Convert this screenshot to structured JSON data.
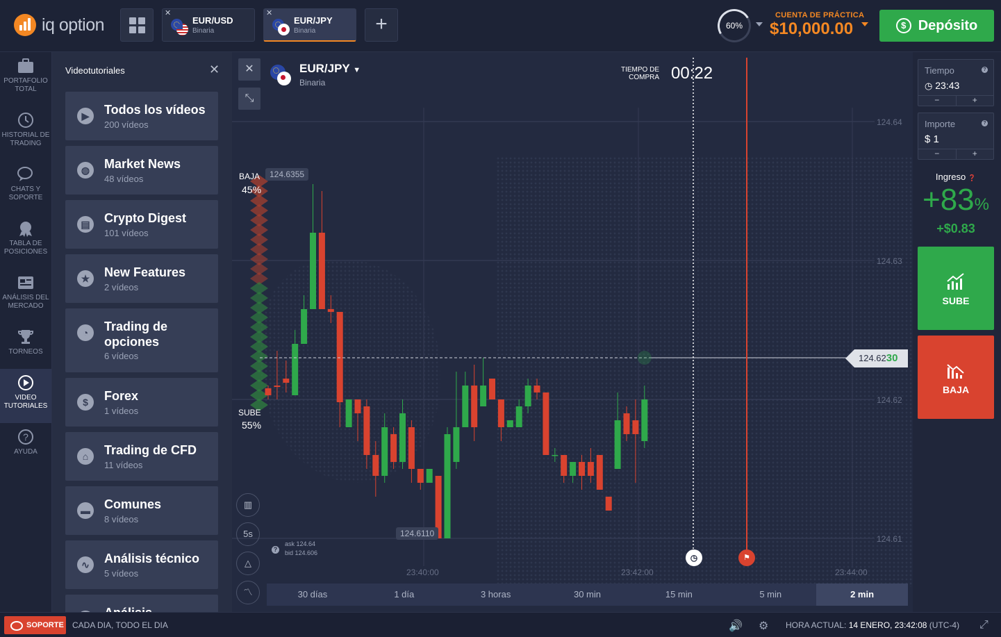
{
  "brand": {
    "name": "iq option"
  },
  "tabs": [
    {
      "pair": "EUR/USD",
      "kind": "Binaria"
    },
    {
      "pair": "EUR/JPY",
      "kind": "Binaria"
    }
  ],
  "header": {
    "percent": "60%",
    "account_label": "CUENTA DE PRÁCTICA",
    "balance": "$10,000.00",
    "deposit_label": "Depósito"
  },
  "nav": [
    {
      "label": "PORTAFOLIO TOTAL"
    },
    {
      "label": "HISTORIAL DE TRADING"
    },
    {
      "label": "CHATS Y SOPORTE"
    },
    {
      "label": "TABLA DE POSICIONES"
    },
    {
      "label": "ANÁLISIS DEL MERCADO"
    },
    {
      "label": "TORNEOS"
    },
    {
      "label": "VIDEO TUTORIALES"
    },
    {
      "label": "AYUDA"
    }
  ],
  "panel": {
    "title": "Videotutoriales",
    "items": [
      {
        "title": "Todos los vídeos",
        "count": "200 vídeos",
        "icon": "play-icon"
      },
      {
        "title": "Market News",
        "count": "48 vídeos",
        "icon": "globe-icon"
      },
      {
        "title": "Crypto Digest",
        "count": "101 vídeos",
        "icon": "newspaper-icon"
      },
      {
        "title": "New Features",
        "count": "2 vídeos",
        "icon": "star-icon"
      },
      {
        "title": "Trading de opciones",
        "count": "6 vídeos",
        "icon": "pie-icon"
      },
      {
        "title": "Forex",
        "count": "1 vídeos",
        "icon": "dollar-icon"
      },
      {
        "title": "Trading de CFD",
        "count": "11 vídeos",
        "icon": "bank-icon"
      },
      {
        "title": "Comunes",
        "count": "8 vídeos",
        "icon": "folder-icon"
      },
      {
        "title": "Análisis técnico",
        "count": "5 vídeos",
        "icon": "chart-icon"
      },
      {
        "title": "Análisis",
        "count": "",
        "icon": "chart-icon"
      }
    ]
  },
  "chart": {
    "pair": "EUR/JPY",
    "kind": "Binaria",
    "buy_time_label_1": "TIEMPO DE",
    "buy_time_label_2": "COMPRA",
    "buy_time": "00:22",
    "baja_label": "BAJA",
    "baja_pct": "45%",
    "sube_label": "SUBE",
    "sube_pct": "55%",
    "high_price": "124.6355",
    "low_price": "124.6110",
    "current_price_main": "124.62",
    "current_price_tail": "30",
    "ask": "ask 124.64",
    "bid": "bid 124.606",
    "interval": "5s",
    "timeframes": [
      "30 días",
      "1 día",
      "3 horas",
      "30 min",
      "15 min",
      "5 min",
      "2 min"
    ],
    "selected_timeframe": "2 min"
  },
  "chart_data": {
    "type": "candlestick",
    "y_ticks": [
      "124.64",
      "124.63",
      "124.62",
      "124.61"
    ],
    "x_ticks": [
      "23:40:00",
      "23:42:00",
      "23:44:00"
    ],
    "ylim": [
      124.61,
      124.64
    ],
    "candles": [
      {
        "o": 124.6208,
        "c": 124.6203,
        "h": 124.621,
        "l": 124.62
      },
      {
        "o": 124.621,
        "c": 124.6209,
        "h": 124.6235,
        "l": 124.62
      },
      {
        "o": 124.6215,
        "c": 124.6212,
        "h": 124.6228,
        "l": 124.6205
      },
      {
        "o": 124.6203,
        "c": 124.624,
        "h": 124.625,
        "l": 124.6203
      },
      {
        "o": 124.624,
        "c": 124.6265,
        "h": 124.6275,
        "l": 124.624
      },
      {
        "o": 124.6265,
        "c": 124.632,
        "h": 124.6355,
        "l": 124.6265
      },
      {
        "o": 124.632,
        "c": 124.6265,
        "h": 124.635,
        "l": 124.6265
      },
      {
        "o": 124.6265,
        "c": 124.6263,
        "h": 124.6275,
        "l": 124.6255
      },
      {
        "o": 124.6263,
        "c": 124.6198,
        "h": 124.6263,
        "l": 124.618
      },
      {
        "o": 124.618,
        "c": 124.62,
        "h": 124.62,
        "l": 124.618
      },
      {
        "o": 124.62,
        "c": 124.619,
        "h": 124.62,
        "l": 124.617
      },
      {
        "o": 124.6195,
        "c": 124.616,
        "h": 124.62,
        "l": 124.615
      },
      {
        "o": 124.616,
        "c": 124.6145,
        "h": 124.617,
        "l": 124.613
      },
      {
        "o": 124.6145,
        "c": 124.618,
        "h": 124.619,
        "l": 124.614
      },
      {
        "o": 124.6175,
        "c": 124.6155,
        "h": 124.618,
        "l": 124.615
      },
      {
        "o": 124.6155,
        "c": 124.619,
        "h": 124.62,
        "l": 124.615
      },
      {
        "o": 124.618,
        "c": 124.615,
        "h": 124.6185,
        "l": 124.614
      },
      {
        "o": 124.615,
        "c": 124.614,
        "h": 124.615,
        "l": 124.6135
      },
      {
        "o": 124.614,
        "c": 124.615,
        "h": 124.615,
        "l": 124.614
      },
      {
        "o": 124.6145,
        "c": 124.61,
        "h": 124.6145,
        "l": 124.61
      },
      {
        "o": 124.61,
        "c": 124.6175,
        "h": 124.618,
        "l": 124.61
      },
      {
        "o": 124.6155,
        "c": 124.618,
        "h": 124.622,
        "l": 124.615
      },
      {
        "o": 124.618,
        "c": 124.621,
        "h": 124.622,
        "l": 124.618
      },
      {
        "o": 124.621,
        "c": 124.618,
        "h": 124.6225,
        "l": 124.617
      },
      {
        "o": 124.6195,
        "c": 124.621,
        "h": 124.623,
        "l": 124.6195
      },
      {
        "o": 124.6215,
        "c": 124.62,
        "h": 124.6215,
        "l": 124.62
      },
      {
        "o": 124.62,
        "c": 124.618,
        "h": 124.62,
        "l": 124.617
      },
      {
        "o": 124.618,
        "c": 124.6185,
        "h": 124.6185,
        "l": 124.618
      },
      {
        "o": 124.618,
        "c": 124.6195,
        "h": 124.62,
        "l": 124.618
      },
      {
        "o": 124.6195,
        "c": 124.621,
        "h": 124.6215,
        "l": 124.619
      },
      {
        "o": 124.621,
        "c": 124.6205,
        "h": 124.6215,
        "l": 124.62
      },
      {
        "o": 124.6205,
        "c": 124.616,
        "h": 124.6205,
        "l": 124.616
      },
      {
        "o": 124.616,
        "c": 124.616,
        "h": 124.6165,
        "l": 124.6155
      },
      {
        "o": 124.616,
        "c": 124.6145,
        "h": 124.616,
        "l": 124.614
      },
      {
        "o": 124.6145,
        "c": 124.6155,
        "h": 124.6155,
        "l": 124.614
      },
      {
        "o": 124.6155,
        "c": 124.6145,
        "h": 124.616,
        "l": 124.6135
      },
      {
        "o": 124.6155,
        "c": 124.6145,
        "h": 124.6165,
        "l": 124.614
      },
      {
        "o": 124.616,
        "c": 124.6135,
        "h": 124.616,
        "l": 124.6135
      },
      {
        "o": 124.613,
        "c": 124.612,
        "h": 124.613,
        "l": 124.612
      },
      {
        "o": 124.615,
        "c": 124.6185,
        "h": 124.6205,
        "l": 124.615
      },
      {
        "o": 124.619,
        "c": 124.6175,
        "h": 124.6195,
        "l": 124.617
      },
      {
        "o": 124.6185,
        "c": 124.6175,
        "h": 124.62,
        "l": 124.614
      },
      {
        "o": 124.617,
        "c": 124.62,
        "h": 124.621,
        "l": 124.6165
      }
    ]
  },
  "trade": {
    "time_label": "Tiempo",
    "time_value": "23:43",
    "amount_label": "Importe",
    "amount_value": "$ 1",
    "income_label": "Ingreso",
    "income_pct": "+83",
    "income_pct_suffix": "%",
    "profit": "+$0.83",
    "call_label": "SUBE",
    "put_label": "BAJA"
  },
  "footer": {
    "support_label": "SOPORTE",
    "tagline": "CADA DIA, TODO EL DIA",
    "time_label": "HORA ACTUAL:",
    "time_value": "14 ENERO, 23:42:08",
    "tz": "(UTC-4)"
  },
  "colors": {
    "accent": "#f48823",
    "up": "#2fa94b",
    "down": "#d9432f"
  }
}
